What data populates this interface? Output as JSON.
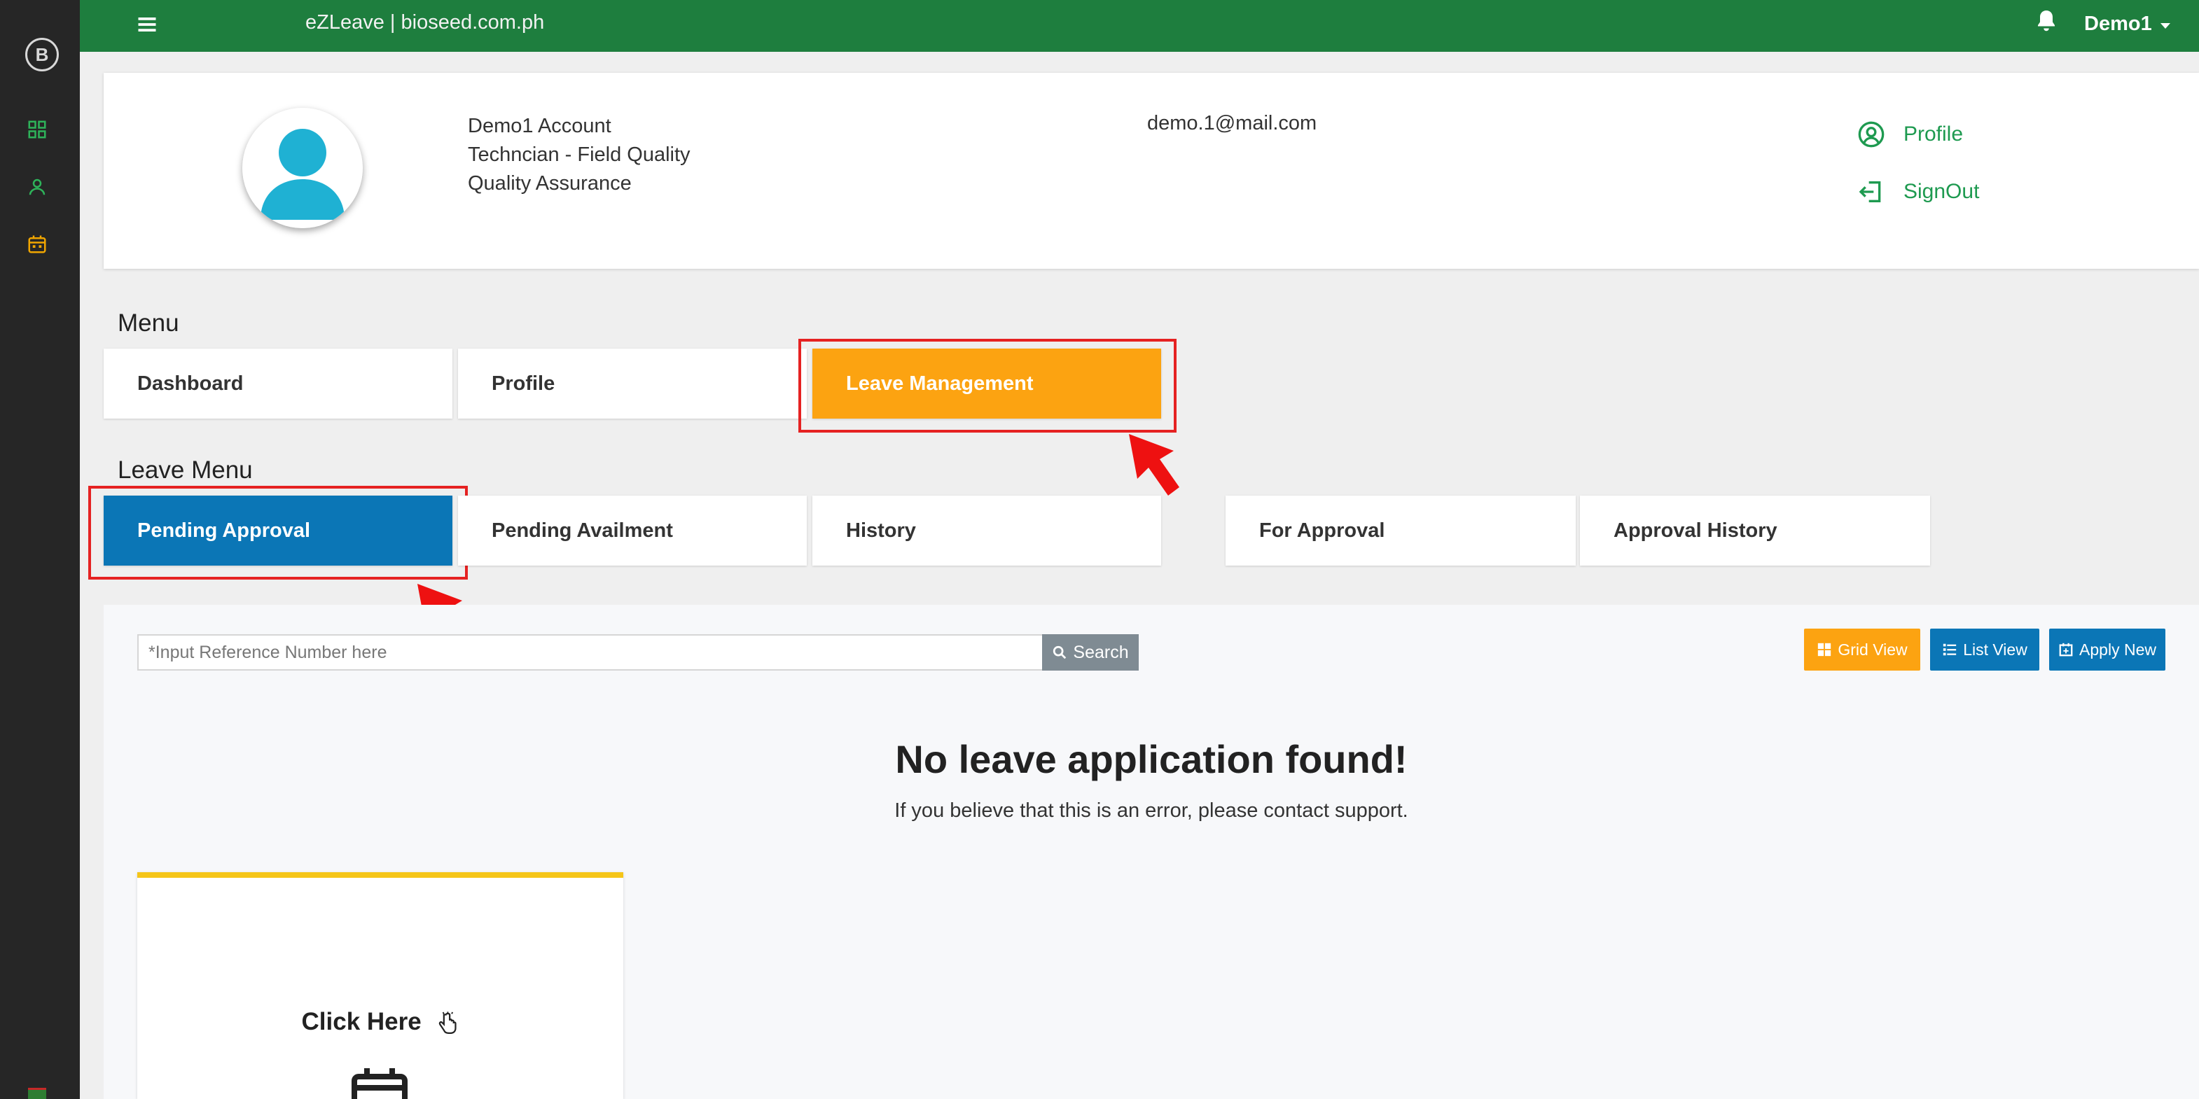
{
  "app": {
    "title": "eZLeave | bioseed.com.ph",
    "user_name": "Demo1",
    "colors": {
      "topbar": "#1e7e3e",
      "sidebar": "#262626",
      "accent_orange": "#fca311",
      "accent_blue": "#0b76b6",
      "link_green": "#1e9a50"
    }
  },
  "sidebar": {
    "icons": [
      "logo-icon",
      "dashboard-icon",
      "user-icon",
      "calendar-icon"
    ]
  },
  "profile": {
    "name": "Demo1 Account",
    "position": "Techncian - Field Quality",
    "department": "Quality Assurance",
    "email": "demo.1@mail.com",
    "links": {
      "profile": "Profile",
      "signout": "SignOut"
    }
  },
  "menu": {
    "title": "Menu",
    "items": [
      {
        "label": "Dashboard"
      },
      {
        "label": "Profile"
      },
      {
        "label": "Leave Management"
      }
    ]
  },
  "leave_menu": {
    "title": "Leave Menu",
    "items": [
      {
        "label": "Pending Approval"
      },
      {
        "label": "Pending Availment"
      },
      {
        "label": "History"
      },
      {
        "label": "For Approval"
      },
      {
        "label": "Approval History"
      }
    ]
  },
  "content": {
    "search_placeholder": "*Input Reference Number here",
    "search_label": "Search",
    "grid_view": "Grid View",
    "list_view": "List View",
    "apply_new": "Apply New",
    "empty_title": "No leave application found!",
    "empty_sub": "If you believe that this is an error, please contact support.",
    "click_here": "Click Here"
  }
}
